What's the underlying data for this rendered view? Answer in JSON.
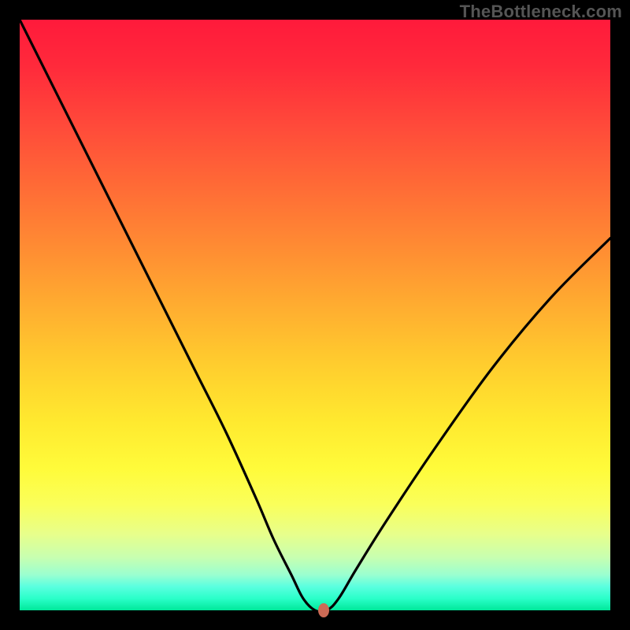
{
  "watermark": "TheBottleneck.com",
  "colors": {
    "frame": "#000000",
    "curve": "#000000",
    "marker": "#cc6a55"
  },
  "chart_data": {
    "type": "line",
    "title": "",
    "xlabel": "",
    "ylabel": "",
    "xlim": [
      0,
      100
    ],
    "ylim": [
      0,
      100
    ],
    "grid": false,
    "legend": false,
    "series": [
      {
        "name": "bottleneck-curve",
        "x": [
          0,
          5,
          10,
          15,
          20,
          25,
          30,
          35,
          40,
          43,
          46,
          48,
          50,
          52,
          54,
          57,
          62,
          70,
          80,
          90,
          100
        ],
        "y": [
          100,
          90,
          80,
          70,
          60,
          50,
          40,
          30,
          19,
          12,
          6,
          2,
          0,
          0,
          2,
          7,
          15,
          27,
          41,
          53,
          63
        ]
      }
    ],
    "marker": {
      "x": 51.5,
      "y": 0
    },
    "notes": "V-shaped bottleneck curve; y is percent bottleneck (0 at optimum near x≈51). Values estimated from pixel positions on a rainbow-gradient background with no visible axes or ticks."
  }
}
